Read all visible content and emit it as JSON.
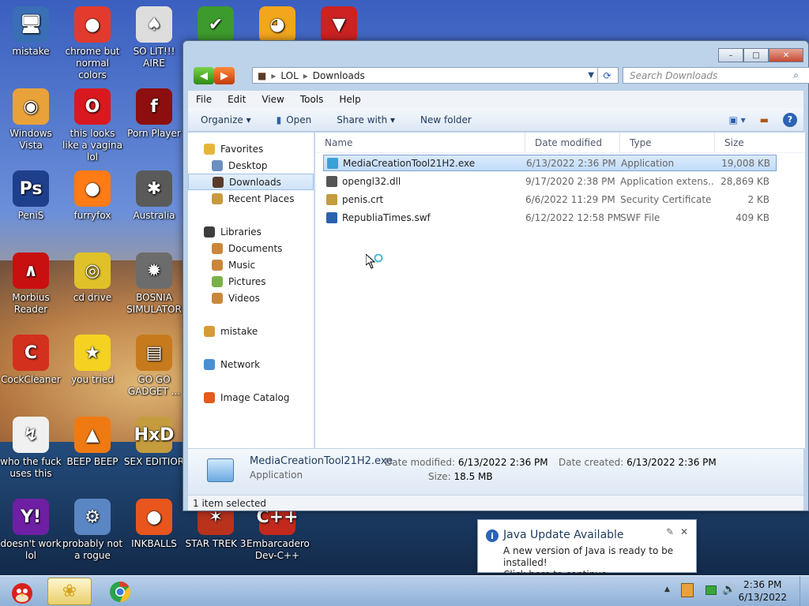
{
  "desktop": {
    "icons": [
      {
        "label": "mistake",
        "glyph": "🖥",
        "color": "#3a6fb5"
      },
      {
        "label": "chrome but normal colors",
        "glyph": "●",
        "color": "#e23b2e"
      },
      {
        "label": "SO LIT!!! AIRE",
        "glyph": "♠",
        "color": "#ddd"
      },
      {
        "label": "",
        "glyph": "✔",
        "color": "#3d9a2d"
      },
      {
        "label": "",
        "glyph": "◕",
        "color": "#f2a61c"
      },
      {
        "label": "",
        "glyph": "▼",
        "color": "#c22"
      },
      {
        "label": "Windows Vista",
        "glyph": "◉",
        "color": "#e9a23a"
      },
      {
        "label": "this looks like a vagina lol",
        "glyph": "O",
        "color": "#d9191f"
      },
      {
        "label": "Porn Player",
        "glyph": "f",
        "color": "#8c0e0e"
      },
      {
        "label": "PeniS",
        "glyph": "Ps",
        "color": "#1e3f8c"
      },
      {
        "label": "furryfox",
        "glyph": "●",
        "color": "#ff7b16"
      },
      {
        "label": "Australia",
        "glyph": "✱",
        "color": "#5a5a5a"
      },
      {
        "label": "Morbius Reader",
        "glyph": "∧",
        "color": "#c91010"
      },
      {
        "label": "cd drive",
        "glyph": "◎",
        "color": "#e0c12a"
      },
      {
        "label": "BOSNIA SIMULATOR",
        "glyph": "✹",
        "color": "#6c6c6c"
      },
      {
        "label": "CockCleaner",
        "glyph": "C",
        "color": "#d3301e"
      },
      {
        "label": "you tried",
        "glyph": "★",
        "color": "#f4d222"
      },
      {
        "label": "GO GO GADGET ...",
        "glyph": "▤",
        "color": "#c77a1c"
      },
      {
        "label": "who the fuck uses this",
        "glyph": "↯",
        "color": "#f0f0f0"
      },
      {
        "label": "BEEP BEEP",
        "glyph": "▲",
        "color": "#f07a12"
      },
      {
        "label": "SEX EDITIOR",
        "glyph": "HxD",
        "color": "#c49c3e"
      },
      {
        "label": "doesn't work lol",
        "glyph": "Y!",
        "color": "#6f1fa3"
      },
      {
        "label": "probably not a rogue",
        "glyph": "⚙",
        "color": "#5b86c4"
      },
      {
        "label": "INKBALLS",
        "glyph": "●",
        "color": "#e8561e"
      },
      {
        "label": "STAR TREK 3",
        "glyph": "✶",
        "color": "#b8321c"
      },
      {
        "label": "Embarcadero Dev-C++",
        "glyph": "C++",
        "color": "#c2291c"
      }
    ]
  },
  "window": {
    "controls": {
      "minimize": "–",
      "maximize": "□",
      "close": "✕"
    },
    "nav": {
      "back": "◀",
      "forward": "▶"
    },
    "breadcrumb": {
      "root": "LOL",
      "sep": "▸",
      "current": "Downloads"
    },
    "search_placeholder": "Search Downloads",
    "menu": [
      "File",
      "Edit",
      "View",
      "Tools",
      "Help"
    ],
    "commands": {
      "organize": "Organize ▾",
      "open": "Open",
      "share": "Share with ▾",
      "new_folder": "New folder"
    },
    "tree": [
      {
        "label": "Favorites",
        "kind": "head",
        "color": "#e7b43a"
      },
      {
        "label": "Desktop",
        "kind": "sub",
        "color": "#6b8fbf"
      },
      {
        "label": "Downloads",
        "kind": "sub",
        "color": "#5a3b2a",
        "selected": true
      },
      {
        "label": "Recent Places",
        "kind": "sub",
        "color": "#c79a3e"
      },
      {
        "gap": true
      },
      {
        "label": "Libraries",
        "kind": "head",
        "color": "#3d3d3d"
      },
      {
        "label": "Documents",
        "kind": "sub",
        "color": "#c9873b"
      },
      {
        "label": "Music",
        "kind": "sub",
        "color": "#c9873b"
      },
      {
        "label": "Pictures",
        "kind": "sub",
        "color": "#7ab04a"
      },
      {
        "label": "Videos",
        "kind": "sub",
        "color": "#c9873b"
      },
      {
        "gap": true
      },
      {
        "label": "mistake",
        "kind": "head",
        "color": "#d99a3a"
      },
      {
        "gap": true
      },
      {
        "label": "Network",
        "kind": "head",
        "color": "#4a8fd1"
      },
      {
        "gap": true
      },
      {
        "label": "Image Catalog",
        "kind": "head",
        "color": "#e35a1c"
      }
    ],
    "columns": {
      "name": "Name",
      "date": "Date modified",
      "type": "Type",
      "size": "Size"
    },
    "files": [
      {
        "name": "MediaCreationTool21H2.exe",
        "date": "6/13/2022 2:36 PM",
        "type": "Application",
        "size": "19,008 KB",
        "color": "#3aa0d8",
        "selected": true
      },
      {
        "name": "opengl32.dll",
        "date": "9/17/2020 2:38 PM",
        "type": "Application extens...",
        "size": "28,869 KB",
        "color": "#555"
      },
      {
        "name": "penis.crt",
        "date": "6/6/2022 11:29 PM",
        "type": "Security Certificate",
        "size": "2 KB",
        "color": "#c49c3e"
      },
      {
        "name": "RepubliaTimes.swf",
        "date": "6/12/2022 12:58 PM",
        "type": "SWF File",
        "size": "409 KB",
        "color": "#2a62b0"
      }
    ],
    "details": {
      "name": "MediaCreationTool21H2.exe",
      "type": "Application",
      "modified_label": "Date modified:",
      "modified": "6/13/2022 2:36 PM",
      "created_label": "Date created:",
      "created": "6/13/2022 2:36 PM",
      "size_label": "Size:",
      "size": "18.5 MB"
    },
    "status": "1 item selected"
  },
  "toast": {
    "title": "Java Update Available",
    "line1": "A new version of Java is ready to be installed!",
    "line2": "Click here to continue.",
    "close": "✕"
  },
  "taskbar": {
    "time": "2:36 PM",
    "date": "6/13/2022"
  }
}
